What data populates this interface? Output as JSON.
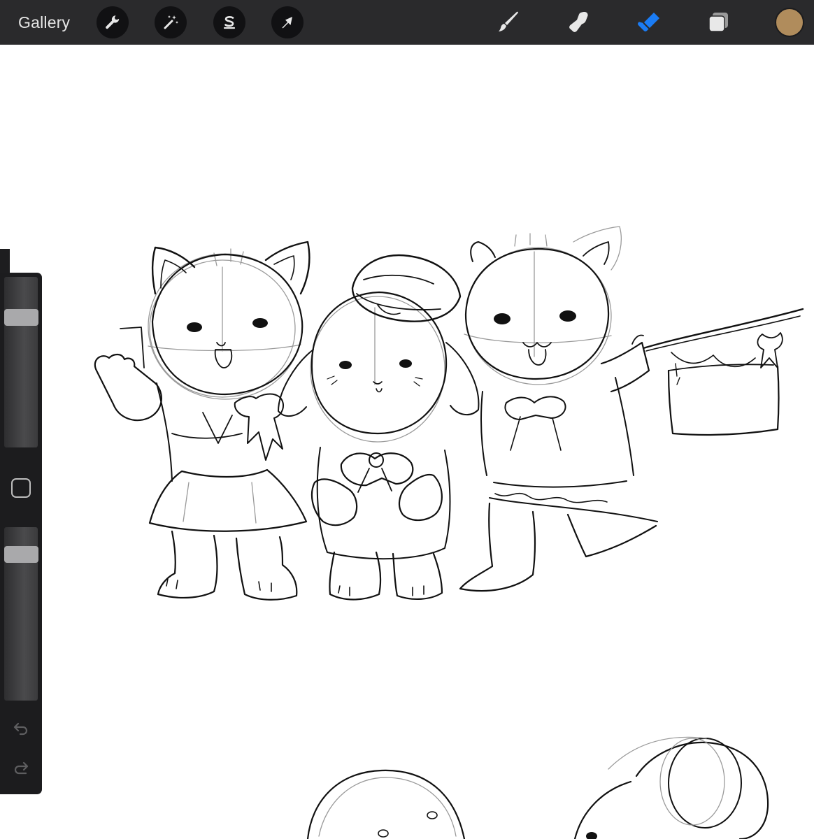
{
  "topbar": {
    "gallery_label": "Gallery",
    "left_tools": [
      {
        "name": "actions",
        "icon": "wrench-icon"
      },
      {
        "name": "adjustments",
        "icon": "magic-wand-icon"
      },
      {
        "name": "selection",
        "icon": "selection-s-icon"
      },
      {
        "name": "transform",
        "icon": "arrow-cursor-icon"
      }
    ],
    "right_tools": [
      {
        "name": "brush",
        "icon": "brush-icon"
      },
      {
        "name": "smudge",
        "icon": "smudge-finger-icon"
      },
      {
        "name": "eraser",
        "icon": "eraser-icon",
        "active": true
      },
      {
        "name": "layers",
        "icon": "layers-icon"
      }
    ],
    "current_color": "#b08c5c"
  },
  "colors": {
    "toolbar_bg": "#2a2a2c",
    "icon_inactive": "#e8e8e8",
    "icon_active": "#1a7cf5",
    "sidebar_bg": "#1c1c1e",
    "canvas_bg": "#ffffff",
    "sketch_stroke": "#111111"
  },
  "sidebar": {
    "brush_size_level": 0.79,
    "opacity_level": 0.88,
    "modify_button_icon": "rounded-square-icon",
    "undo_icon": "undo-arrow-icon",
    "redo_icon": "redo-arrow-icon"
  },
  "canvas": {
    "content": "pencil-sketch"
  }
}
